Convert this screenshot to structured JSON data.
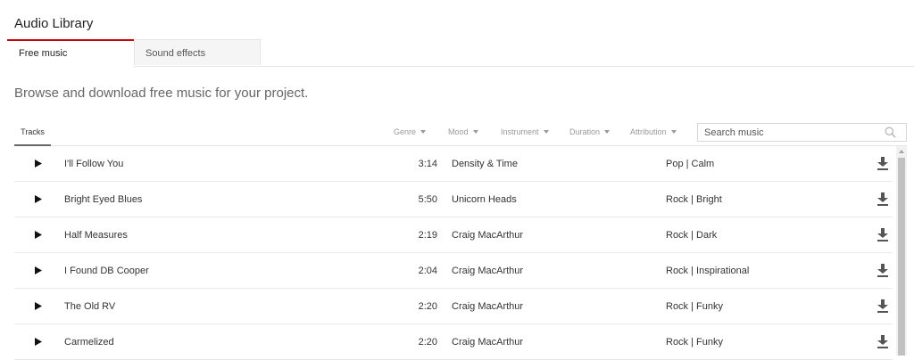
{
  "header": {
    "title": "Audio Library"
  },
  "tabs": [
    {
      "label": "Free music"
    },
    {
      "label": "Sound effects"
    }
  ],
  "intro": "Browse and download free music for your project.",
  "filters": {
    "tracks_label": "Tracks",
    "genre": "Genre",
    "mood": "Mood",
    "instrument": "Instrument",
    "duration": "Duration",
    "attribution": "Attribution"
  },
  "search": {
    "placeholder": "Search music",
    "value": ""
  },
  "tracks": [
    {
      "title": "I'll Follow You",
      "duration": "3:14",
      "artist": "Density & Time",
      "genre": "Pop | Calm"
    },
    {
      "title": "Bright Eyed Blues",
      "duration": "5:50",
      "artist": "Unicorn Heads",
      "genre": "Rock | Bright"
    },
    {
      "title": "Half Measures",
      "duration": "2:19",
      "artist": "Craig MacArthur",
      "genre": "Rock | Dark"
    },
    {
      "title": "I Found DB Cooper",
      "duration": "2:04",
      "artist": "Craig MacArthur",
      "genre": "Rock | Inspirational"
    },
    {
      "title": "The Old RV",
      "duration": "2:20",
      "artist": "Craig MacArthur",
      "genre": "Rock | Funky"
    },
    {
      "title": "Carmelized",
      "duration": "2:20",
      "artist": "Craig MacArthur",
      "genre": "Rock | Funky"
    }
  ],
  "colors": {
    "accent": "#cc0000"
  },
  "icons": {
    "play": "play-icon",
    "download": "download-icon",
    "search": "search-icon"
  }
}
